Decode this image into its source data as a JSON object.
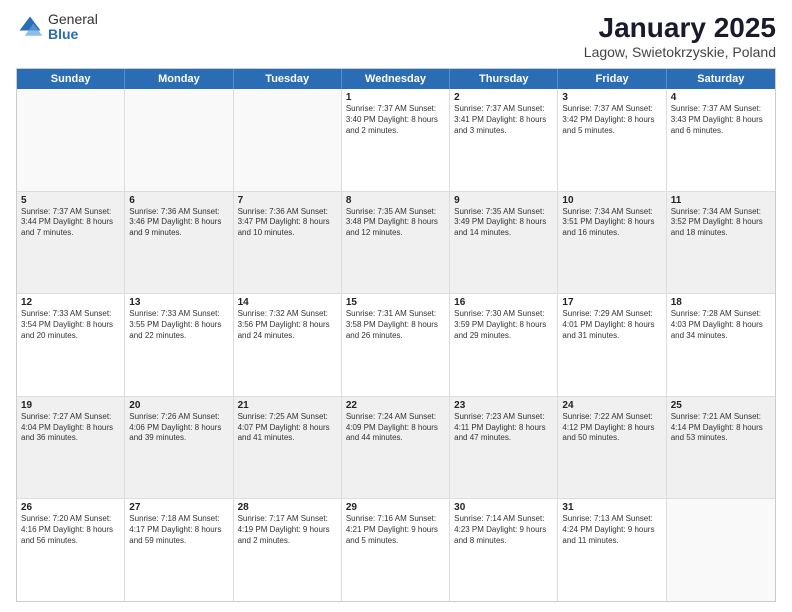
{
  "logo": {
    "general": "General",
    "blue": "Blue"
  },
  "title": "January 2025",
  "subtitle": "Lagow, Swietokrzyskie, Poland",
  "days": [
    "Sunday",
    "Monday",
    "Tuesday",
    "Wednesday",
    "Thursday",
    "Friday",
    "Saturday"
  ],
  "weeks": [
    [
      {
        "day": "",
        "empty": true
      },
      {
        "day": "",
        "empty": true
      },
      {
        "day": "",
        "empty": true
      },
      {
        "day": "1",
        "text": "Sunrise: 7:37 AM\nSunset: 3:40 PM\nDaylight: 8 hours and 2 minutes."
      },
      {
        "day": "2",
        "text": "Sunrise: 7:37 AM\nSunset: 3:41 PM\nDaylight: 8 hours and 3 minutes."
      },
      {
        "day": "3",
        "text": "Sunrise: 7:37 AM\nSunset: 3:42 PM\nDaylight: 8 hours and 5 minutes."
      },
      {
        "day": "4",
        "text": "Sunrise: 7:37 AM\nSunset: 3:43 PM\nDaylight: 8 hours and 6 minutes."
      }
    ],
    [
      {
        "day": "5",
        "text": "Sunrise: 7:37 AM\nSunset: 3:44 PM\nDaylight: 8 hours and 7 minutes."
      },
      {
        "day": "6",
        "text": "Sunrise: 7:36 AM\nSunset: 3:46 PM\nDaylight: 8 hours and 9 minutes."
      },
      {
        "day": "7",
        "text": "Sunrise: 7:36 AM\nSunset: 3:47 PM\nDaylight: 8 hours and 10 minutes."
      },
      {
        "day": "8",
        "text": "Sunrise: 7:35 AM\nSunset: 3:48 PM\nDaylight: 8 hours and 12 minutes."
      },
      {
        "day": "9",
        "text": "Sunrise: 7:35 AM\nSunset: 3:49 PM\nDaylight: 8 hours and 14 minutes."
      },
      {
        "day": "10",
        "text": "Sunrise: 7:34 AM\nSunset: 3:51 PM\nDaylight: 8 hours and 16 minutes."
      },
      {
        "day": "11",
        "text": "Sunrise: 7:34 AM\nSunset: 3:52 PM\nDaylight: 8 hours and 18 minutes."
      }
    ],
    [
      {
        "day": "12",
        "text": "Sunrise: 7:33 AM\nSunset: 3:54 PM\nDaylight: 8 hours and 20 minutes."
      },
      {
        "day": "13",
        "text": "Sunrise: 7:33 AM\nSunset: 3:55 PM\nDaylight: 8 hours and 22 minutes."
      },
      {
        "day": "14",
        "text": "Sunrise: 7:32 AM\nSunset: 3:56 PM\nDaylight: 8 hours and 24 minutes."
      },
      {
        "day": "15",
        "text": "Sunrise: 7:31 AM\nSunset: 3:58 PM\nDaylight: 8 hours and 26 minutes."
      },
      {
        "day": "16",
        "text": "Sunrise: 7:30 AM\nSunset: 3:59 PM\nDaylight: 8 hours and 29 minutes."
      },
      {
        "day": "17",
        "text": "Sunrise: 7:29 AM\nSunset: 4:01 PM\nDaylight: 8 hours and 31 minutes."
      },
      {
        "day": "18",
        "text": "Sunrise: 7:28 AM\nSunset: 4:03 PM\nDaylight: 8 hours and 34 minutes."
      }
    ],
    [
      {
        "day": "19",
        "text": "Sunrise: 7:27 AM\nSunset: 4:04 PM\nDaylight: 8 hours and 36 minutes."
      },
      {
        "day": "20",
        "text": "Sunrise: 7:26 AM\nSunset: 4:06 PM\nDaylight: 8 hours and 39 minutes."
      },
      {
        "day": "21",
        "text": "Sunrise: 7:25 AM\nSunset: 4:07 PM\nDaylight: 8 hours and 41 minutes."
      },
      {
        "day": "22",
        "text": "Sunrise: 7:24 AM\nSunset: 4:09 PM\nDaylight: 8 hours and 44 minutes."
      },
      {
        "day": "23",
        "text": "Sunrise: 7:23 AM\nSunset: 4:11 PM\nDaylight: 8 hours and 47 minutes."
      },
      {
        "day": "24",
        "text": "Sunrise: 7:22 AM\nSunset: 4:12 PM\nDaylight: 8 hours and 50 minutes."
      },
      {
        "day": "25",
        "text": "Sunrise: 7:21 AM\nSunset: 4:14 PM\nDaylight: 8 hours and 53 minutes."
      }
    ],
    [
      {
        "day": "26",
        "text": "Sunrise: 7:20 AM\nSunset: 4:16 PM\nDaylight: 8 hours and 56 minutes."
      },
      {
        "day": "27",
        "text": "Sunrise: 7:18 AM\nSunset: 4:17 PM\nDaylight: 8 hours and 59 minutes."
      },
      {
        "day": "28",
        "text": "Sunrise: 7:17 AM\nSunset: 4:19 PM\nDaylight: 9 hours and 2 minutes."
      },
      {
        "day": "29",
        "text": "Sunrise: 7:16 AM\nSunset: 4:21 PM\nDaylight: 9 hours and 5 minutes."
      },
      {
        "day": "30",
        "text": "Sunrise: 7:14 AM\nSunset: 4:23 PM\nDaylight: 9 hours and 8 minutes."
      },
      {
        "day": "31",
        "text": "Sunrise: 7:13 AM\nSunset: 4:24 PM\nDaylight: 9 hours and 11 minutes."
      },
      {
        "day": "",
        "empty": true
      }
    ]
  ]
}
